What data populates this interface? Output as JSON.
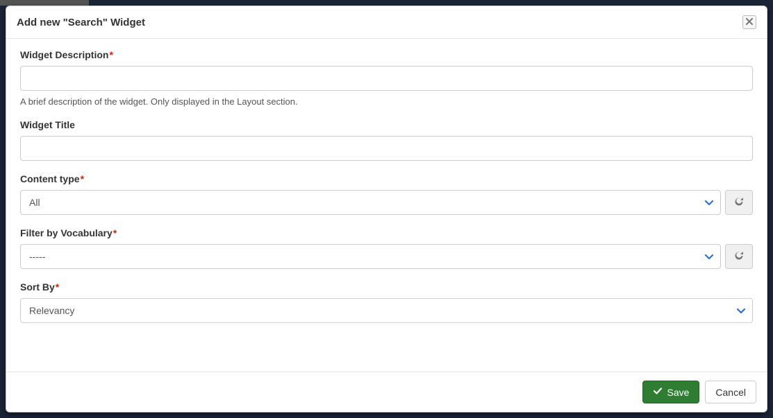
{
  "modal": {
    "title": "Add new \"Search\" Widget"
  },
  "form": {
    "widget_description": {
      "label": "Widget Description",
      "required": true,
      "value": "",
      "help": "A brief description of the widget. Only displayed in the Layout section."
    },
    "widget_title": {
      "label": "Widget Title",
      "required": false,
      "value": ""
    },
    "content_type": {
      "label": "Content type",
      "required": true,
      "value": "All"
    },
    "filter_vocab": {
      "label": "Filter by Vocabulary",
      "required": true,
      "value": "-----"
    },
    "sort_by": {
      "label": "Sort By",
      "required": true,
      "value": "Relevancy"
    }
  },
  "footer": {
    "save": "Save",
    "cancel": "Cancel"
  }
}
